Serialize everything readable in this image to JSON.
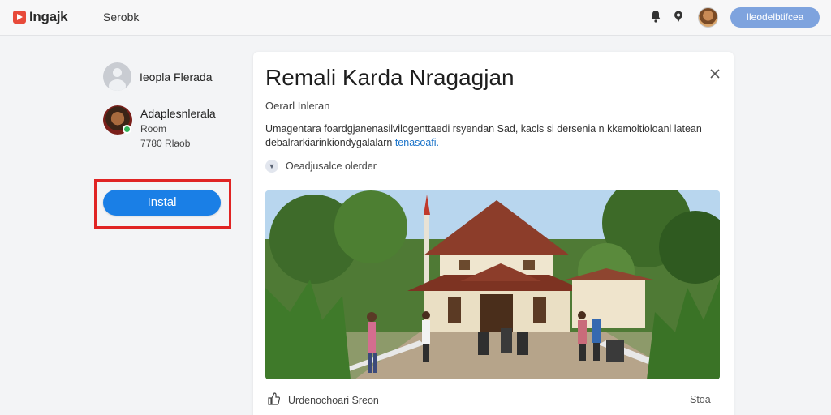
{
  "header": {
    "logo_text": "Ingajk",
    "search_label": "Serobk",
    "action_button": "Ileodelbtifcea",
    "icons": [
      "bell-icon",
      "pin-icon",
      "avatar"
    ]
  },
  "sidebar": {
    "profile_1": {
      "name": "Ieopla Flerada"
    },
    "profile_2": {
      "name": "Adaplesnlerala",
      "line_1": "Room",
      "line_2": "7780 Rlaob"
    },
    "install_label": "Instal",
    "highlight_color": "#e02424"
  },
  "card": {
    "title": "Remali Karda Nragagjan",
    "subtitle": "Oerarl Inleran",
    "description": "Umagentara foardgjanenasilvilogenttaedi rsyendan Sad, kacls si dersenia n kkemoltioloanl latean debalrarkiarinkiondygalalarn",
    "description_link": "tenasoafi.",
    "meta_text": "Oeadjusalce olerder",
    "footer_text": "Urdenochoari Sreon",
    "footer_right": "Stoa",
    "accent_color": "#1a7fe6"
  }
}
